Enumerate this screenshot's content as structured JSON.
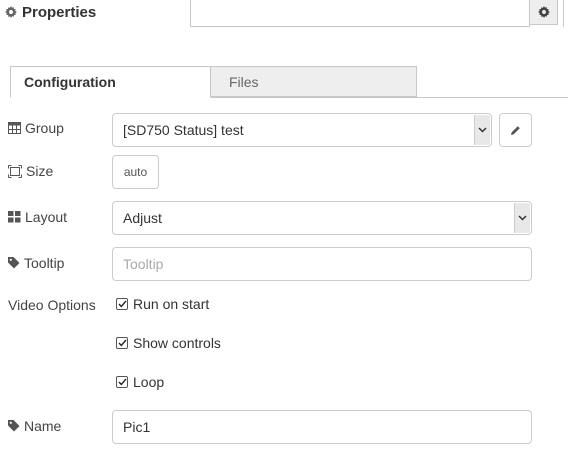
{
  "header": {
    "title": "Properties",
    "icon": "gear-icon",
    "settings_icon": "gear-icon"
  },
  "tabs": [
    {
      "label": "Configuration",
      "active": true
    },
    {
      "label": "Files",
      "active": false
    }
  ],
  "form": {
    "group": {
      "label": "Group",
      "icon": "table-icon",
      "value": "[SD750 Status] test",
      "edit_icon": "pencil-icon"
    },
    "size": {
      "label": "Size",
      "icon": "resize-icon",
      "value": "auto"
    },
    "layout": {
      "label": "Layout",
      "icon": "grid-icon",
      "value": "Adjust"
    },
    "tooltip": {
      "label": "Tooltip",
      "icon": "tag-icon",
      "placeholder": "Tooltip",
      "value": ""
    },
    "video_options": {
      "label": "Video Options",
      "options": [
        {
          "label": "Run on start",
          "checked": true
        },
        {
          "label": "Show controls",
          "checked": true
        },
        {
          "label": "Loop",
          "checked": true
        }
      ]
    },
    "name": {
      "label": "Name",
      "icon": "tag-icon",
      "value": "Pic1"
    }
  },
  "colors": {
    "accent_bg": "#eeeeee",
    "border": "#cccccc",
    "text": "#333333"
  }
}
